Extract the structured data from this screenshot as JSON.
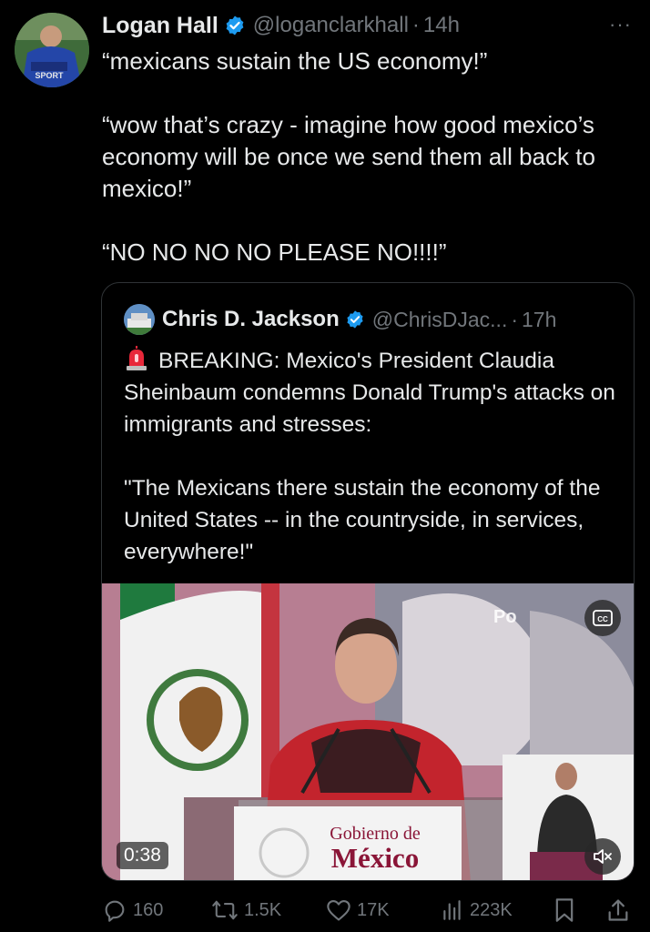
{
  "tweet": {
    "author": "Logan Hall",
    "handle": "@loganclarkhall",
    "separator": "·",
    "time": "14h",
    "more_label": "···",
    "paragraphs": [
      "“mexicans sustain the US economy!”",
      "“wow that’s crazy - imagine how good mexico’s economy will be once we send them all back to mexico!”",
      "“NO NO NO NO PLEASE NO!!!!”"
    ],
    "avatar_text": "SPORT"
  },
  "quote": {
    "author": "Chris D. Jackson",
    "handle": "@ChrisDJac...",
    "separator": "·",
    "time": "17h",
    "paragraph1": "BREAKING: Mexico's President Claudia Sheinbaum condemns Donald Trump's attacks on immigrants and stresses:",
    "paragraph2": "\"The Mexicans there sustain the economy of the United States -- in the countryside, in services, everywhere!\"",
    "video": {
      "duration": "0:38",
      "watermark": "Po",
      "podium_line1": "Gobierno de",
      "podium_line2": "México",
      "cc_icon": "closed-captions-icon",
      "mute_icon": "muted-speaker-icon"
    }
  },
  "actions": {
    "replies": "160",
    "reposts": "1.5K",
    "likes": "17K",
    "views": "223K"
  },
  "colors": {
    "background": "#000000",
    "text": "#e7e9ea",
    "secondary": "#71767b",
    "verified": "#1d9bf0",
    "border": "#2f3336"
  }
}
